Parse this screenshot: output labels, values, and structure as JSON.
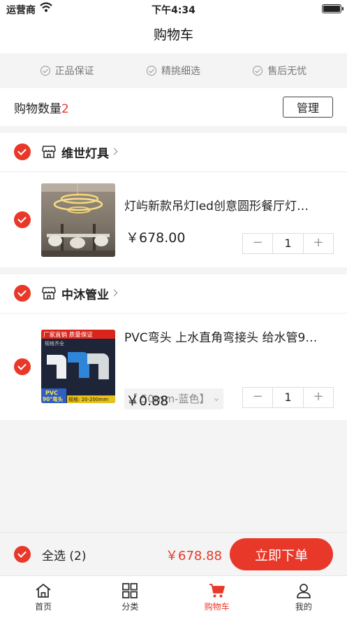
{
  "status_bar": {
    "carrier": "运营商",
    "time": "下午4:34"
  },
  "header": {
    "title": "购物车"
  },
  "guarantees": [
    "正品保证",
    "精挑细选",
    "售后无忧"
  ],
  "cart_count": {
    "label": "购物数量",
    "value": "2",
    "manage_label": "管理"
  },
  "stores": [
    {
      "name": "维世灯具",
      "items": [
        {
          "title": "灯屿新款吊灯led创意圆形餐厅灯…",
          "price": "￥678.00",
          "qty": "1"
        }
      ]
    },
    {
      "name": "中沐管业",
      "items": [
        {
          "title": "PVC弯头 上水直角弯接头 给水管9…",
          "sku": "【 50mm-蓝色】",
          "price": "￥0.88",
          "qty": "1",
          "image_text": {
            "banner": "厂家直销 质量保证",
            "sub": "规格齐全",
            "badge1": "PVC",
            "badge2": "90°弯头",
            "spec": "规格: 20-200mm"
          }
        }
      ]
    }
  ],
  "stepper": {
    "minus": "−",
    "plus": "+"
  },
  "footer": {
    "select_all": "全选 (2)",
    "total": "￥678.88",
    "order_label": "立即下单"
  },
  "tabs": [
    {
      "label": "首页",
      "icon": "home-icon"
    },
    {
      "label": "分类",
      "icon": "grid-icon"
    },
    {
      "label": "购物车",
      "icon": "cart-icon",
      "active": true
    },
    {
      "label": "我的",
      "icon": "user-icon"
    }
  ],
  "colors": {
    "accent": "#e8382a",
    "background": "#f4f4f4"
  }
}
